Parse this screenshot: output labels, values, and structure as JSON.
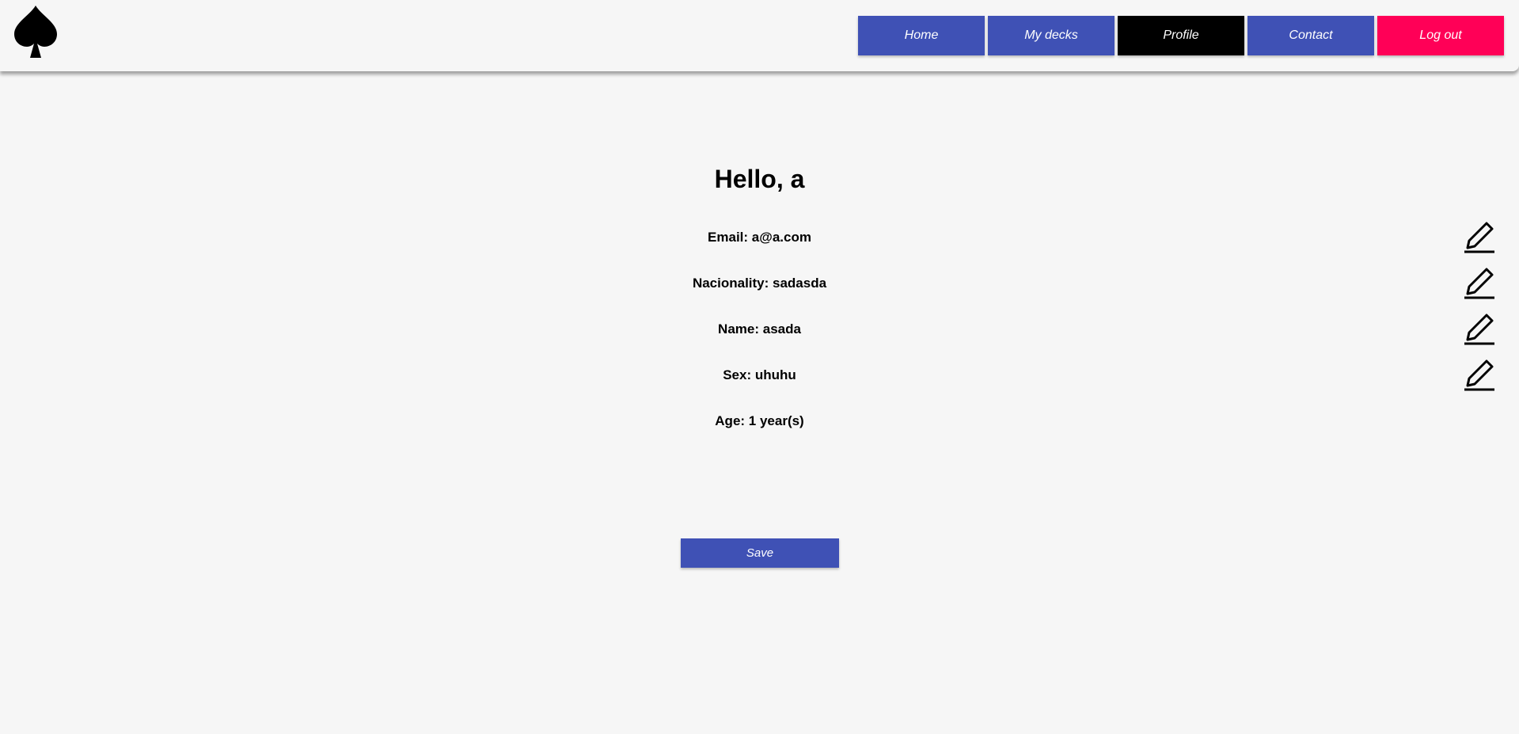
{
  "colors": {
    "primary": "#3f51b5",
    "active": "#000000",
    "danger": "#ff0057"
  },
  "nav": {
    "logo_icon": "spade-icon",
    "items": [
      {
        "label": "Home",
        "color": "#3f51b5"
      },
      {
        "label": "My decks",
        "color": "#3f51b5"
      },
      {
        "label": "Profile",
        "color": "#000000"
      },
      {
        "label": "Contact",
        "color": "#3f51b5"
      },
      {
        "label": "Log out",
        "color": "#ff0057"
      }
    ]
  },
  "profile": {
    "greeting": "Hello, a",
    "fields": [
      {
        "text": "Email: a@a.com",
        "editable": true
      },
      {
        "text": "Nacionality: sadasda",
        "editable": true
      },
      {
        "text": "Name: asada",
        "editable": true
      },
      {
        "text": "Sex: uhuhu",
        "editable": true
      },
      {
        "text": "Age: 1 year(s)",
        "editable": false
      }
    ],
    "edit_icon": "pencil-icon",
    "save_label": "Save"
  }
}
